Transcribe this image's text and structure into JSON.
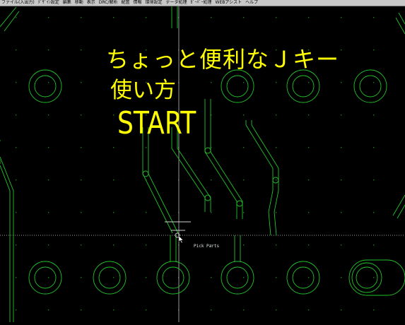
{
  "menu": {
    "items": [
      "ファイル(入出力)",
      "ﾃﾞｻﾞｲﾝ設定",
      "編集",
      "移動",
      "表示",
      "DRC/解析",
      "配置",
      "情報",
      "環境設定",
      "データ処理",
      "ｶﾞｰﾊﾞｰ処理",
      "WEBアシスト",
      "ヘルプ"
    ]
  },
  "captions": {
    "line1": "ちょっと便利なＪキー",
    "line2": "使い方",
    "line3": "START"
  },
  "cursor": {
    "label": "Pick Parts"
  },
  "colors": {
    "background": "#000000",
    "trace": "#22c42a",
    "grid_dot": "#1c7a1c",
    "caption": "#ffff00",
    "crosshair": "#c8c8c8"
  }
}
